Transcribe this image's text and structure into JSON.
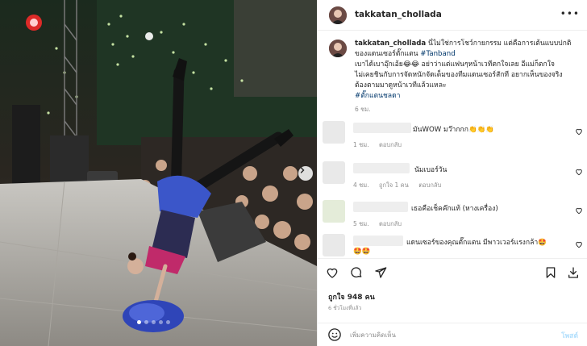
{
  "post": {
    "username": "takkatan_chollada",
    "more_icon": "more-horizontal-icon"
  },
  "caption": {
    "username": "takkatan_chollada",
    "line1": "นี่ไม่ใช่การโชว์กายกรรม แต่คือการเต้นแบบปกติ",
    "line2_pre": "ของแดนเซอร์ตั๊กแตน ",
    "tag1": "#Tanband",
    "line3": "เบาได้เบาอุ๊กเอ้ย😂😂 อย่าว่าแต่แฟนๆหน้าเวทีตกใจเลย อีแม่ก็ตกใจ",
    "line4": "ไม่เคยชินกับการจัดหนักจัดเต็มของทีมแดนเซอร์สักที อยากเห็นของจริง",
    "line5": "ต้องตามมาดูหน้าเวทีแล้วแหละ",
    "tag2": "#ตั๊กแตนชลดา",
    "time": "6 ชม."
  },
  "comments": [
    {
      "text": "มันWOW มว๊ากกก👏👏👏",
      "time": "1 ชม.",
      "likes": "",
      "reply": "ตอบกลับ"
    },
    {
      "text": "นัมเบอร์วัน",
      "time": "4 ชม.",
      "likes": "ถูกใจ 1 คน",
      "reply": "ตอบกลับ"
    },
    {
      "text": "เธอคือเช็คค๊กแท้ (หางเครื่อง)",
      "time": "5 ชม.",
      "likes": "",
      "reply": "ตอบกลับ"
    },
    {
      "text": "แดนเซอร์ของคุณตั๊กแตน มีพาวเวอร์แรงกล้า🤩",
      "text2": "🤩🤩",
      "time": "",
      "likes": "",
      "reply": ""
    }
  ],
  "actions": {
    "likes": "ถูกใจ 948 คน",
    "posted": "6 ชั่วโมงที่แล้ว"
  },
  "add_comment": {
    "placeholder": "เพิ่มความคิดเห็น",
    "post_label": "โพสต์"
  },
  "colors": {
    "link": "#00376b",
    "muted": "#8e8e8e",
    "post_disabled": "#b2dffc"
  }
}
